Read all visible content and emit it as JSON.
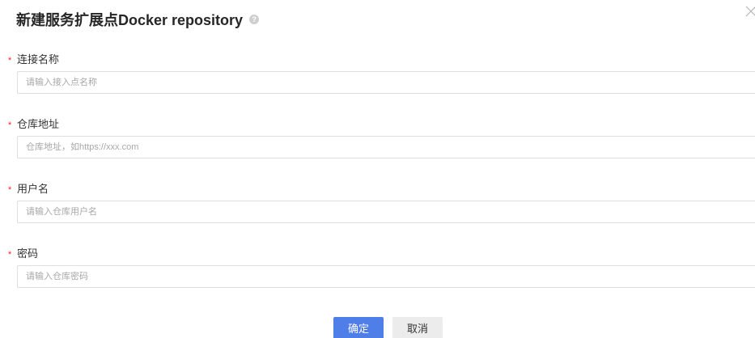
{
  "dialog": {
    "title": "新建服务扩展点Docker repository",
    "help_icon": "question-circle-icon",
    "close_icon": "close-icon"
  },
  "form": {
    "required_mark": "*",
    "fields": [
      {
        "label": "连接名称",
        "value": "",
        "placeholder": "请输入接入点名称"
      },
      {
        "label": "仓库地址",
        "value": "",
        "placeholder": "仓库地址，如https://xxx.com"
      },
      {
        "label": "用户名",
        "value": "",
        "placeholder": "请输入仓库用户名"
      },
      {
        "label": "密码",
        "value": "",
        "placeholder": "请输入仓库密码"
      }
    ]
  },
  "footer": {
    "confirm_label": "确定",
    "cancel_label": "取消"
  },
  "colors": {
    "primary": "#4f7ee8",
    "required": "#f5222d",
    "border": "#dcdfe6"
  }
}
